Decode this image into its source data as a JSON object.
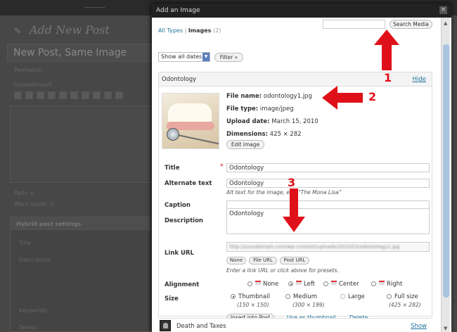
{
  "background": {
    "topbar_text": "———",
    "page_title": "Add New Post",
    "post_title": "New Post, Same Image",
    "permalink_label": "Permalink:",
    "upload_label": "Upload/Insert",
    "path_label": "Path: p",
    "word_count_label": "Word count: 0",
    "box_title": "Hybrid post settings",
    "box_field_title": "Title",
    "box_field_description": "Description",
    "box_field_keywords": "Keywords:",
    "box_field_series": "Series:"
  },
  "modal": {
    "title": "Add an Image",
    "close_glyph": "×",
    "filter": {
      "all_types": "All Types",
      "separator": "|",
      "images": "Images",
      "images_count": "(2)"
    },
    "search": {
      "input_value": "",
      "button_label": "Search Media"
    },
    "date_filter": {
      "selected": "Show all dates",
      "filter_button": "Filter »"
    },
    "attachment": {
      "name": "Odontology",
      "hide_label": "Hide",
      "file_name_label": "File name:",
      "file_name": "odontology1.jpg",
      "file_type_label": "File type:",
      "file_type": "image/jpeg",
      "upload_date_label": "Upload date:",
      "upload_date": "March 15, 2010",
      "dimensions_label": "Dimensions:",
      "dimensions": "425 × 282",
      "edit_image_button": "Edit image",
      "fields": {
        "title_label": "Title",
        "required_mark": "*",
        "title_value": "Odontology",
        "alt_label": "Alternate text",
        "alt_value": "Odontology",
        "alt_hint": "Alt text for the image, e.g. “The Mona Lisa”",
        "caption_label": "Caption",
        "caption_value": "",
        "description_label": "Description",
        "description_value": "Odontology",
        "link_url_label": "Link URL",
        "link_url_value": "http://yourdomain.com/wp-content/uploads/2010/03/odontology1.jpg",
        "link_buttons": [
          "None",
          "File URL",
          "Post URL"
        ],
        "link_hint": "Enter a link URL or click above for presets.",
        "alignment_label": "Alignment",
        "alignment_options": [
          "None",
          "Left",
          "Center",
          "Right"
        ],
        "alignment_selected": "Left",
        "size_label": "Size",
        "size_options": [
          {
            "label": "Thumbnail",
            "dims": "(150 × 150)"
          },
          {
            "label": "Medium",
            "dims": "(300 × 199)"
          },
          {
            "label": "Large",
            "dims": ""
          },
          {
            "label": "Full size",
            "dims": "(425 × 282)"
          }
        ],
        "size_selected": "Thumbnail",
        "insert_button": "Insert into Post",
        "use_thumbnail_link": "Use as thumbnail",
        "delete_link": "Delete"
      }
    },
    "next_item": {
      "name": "Death and Taxes",
      "show_label": "Show"
    }
  },
  "annotations": {
    "marker_1": "1",
    "marker_2": "2",
    "marker_3": "3",
    "arrow_color": "#e0101a"
  }
}
